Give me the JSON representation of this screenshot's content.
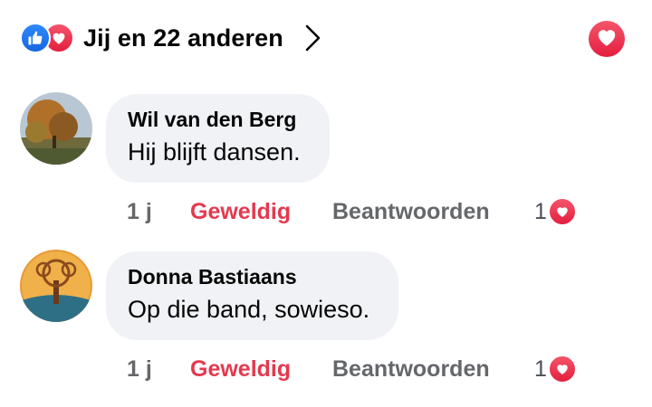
{
  "reactions": {
    "summary": "Jij en 22 anderen",
    "icons": [
      "like-icon",
      "love-icon"
    ]
  },
  "comments": [
    {
      "author": "Wil van den Berg",
      "text": "Hij blijft dansen.",
      "time": "1 j",
      "reaction_label": "Geweldig",
      "reply_label": "Beantwoorden",
      "reaction_count": "1"
    },
    {
      "author": "Donna Bastiaans",
      "text": "Op die band, sowieso.",
      "time": "1 j",
      "reaction_label": "Geweldig",
      "reply_label": "Beantwoorden",
      "reaction_count": "1"
    }
  ],
  "colors": {
    "like": "#1877f2",
    "love": "#e41e3f",
    "bubble": "#f0f2f5",
    "secondary_text": "#65676b"
  }
}
